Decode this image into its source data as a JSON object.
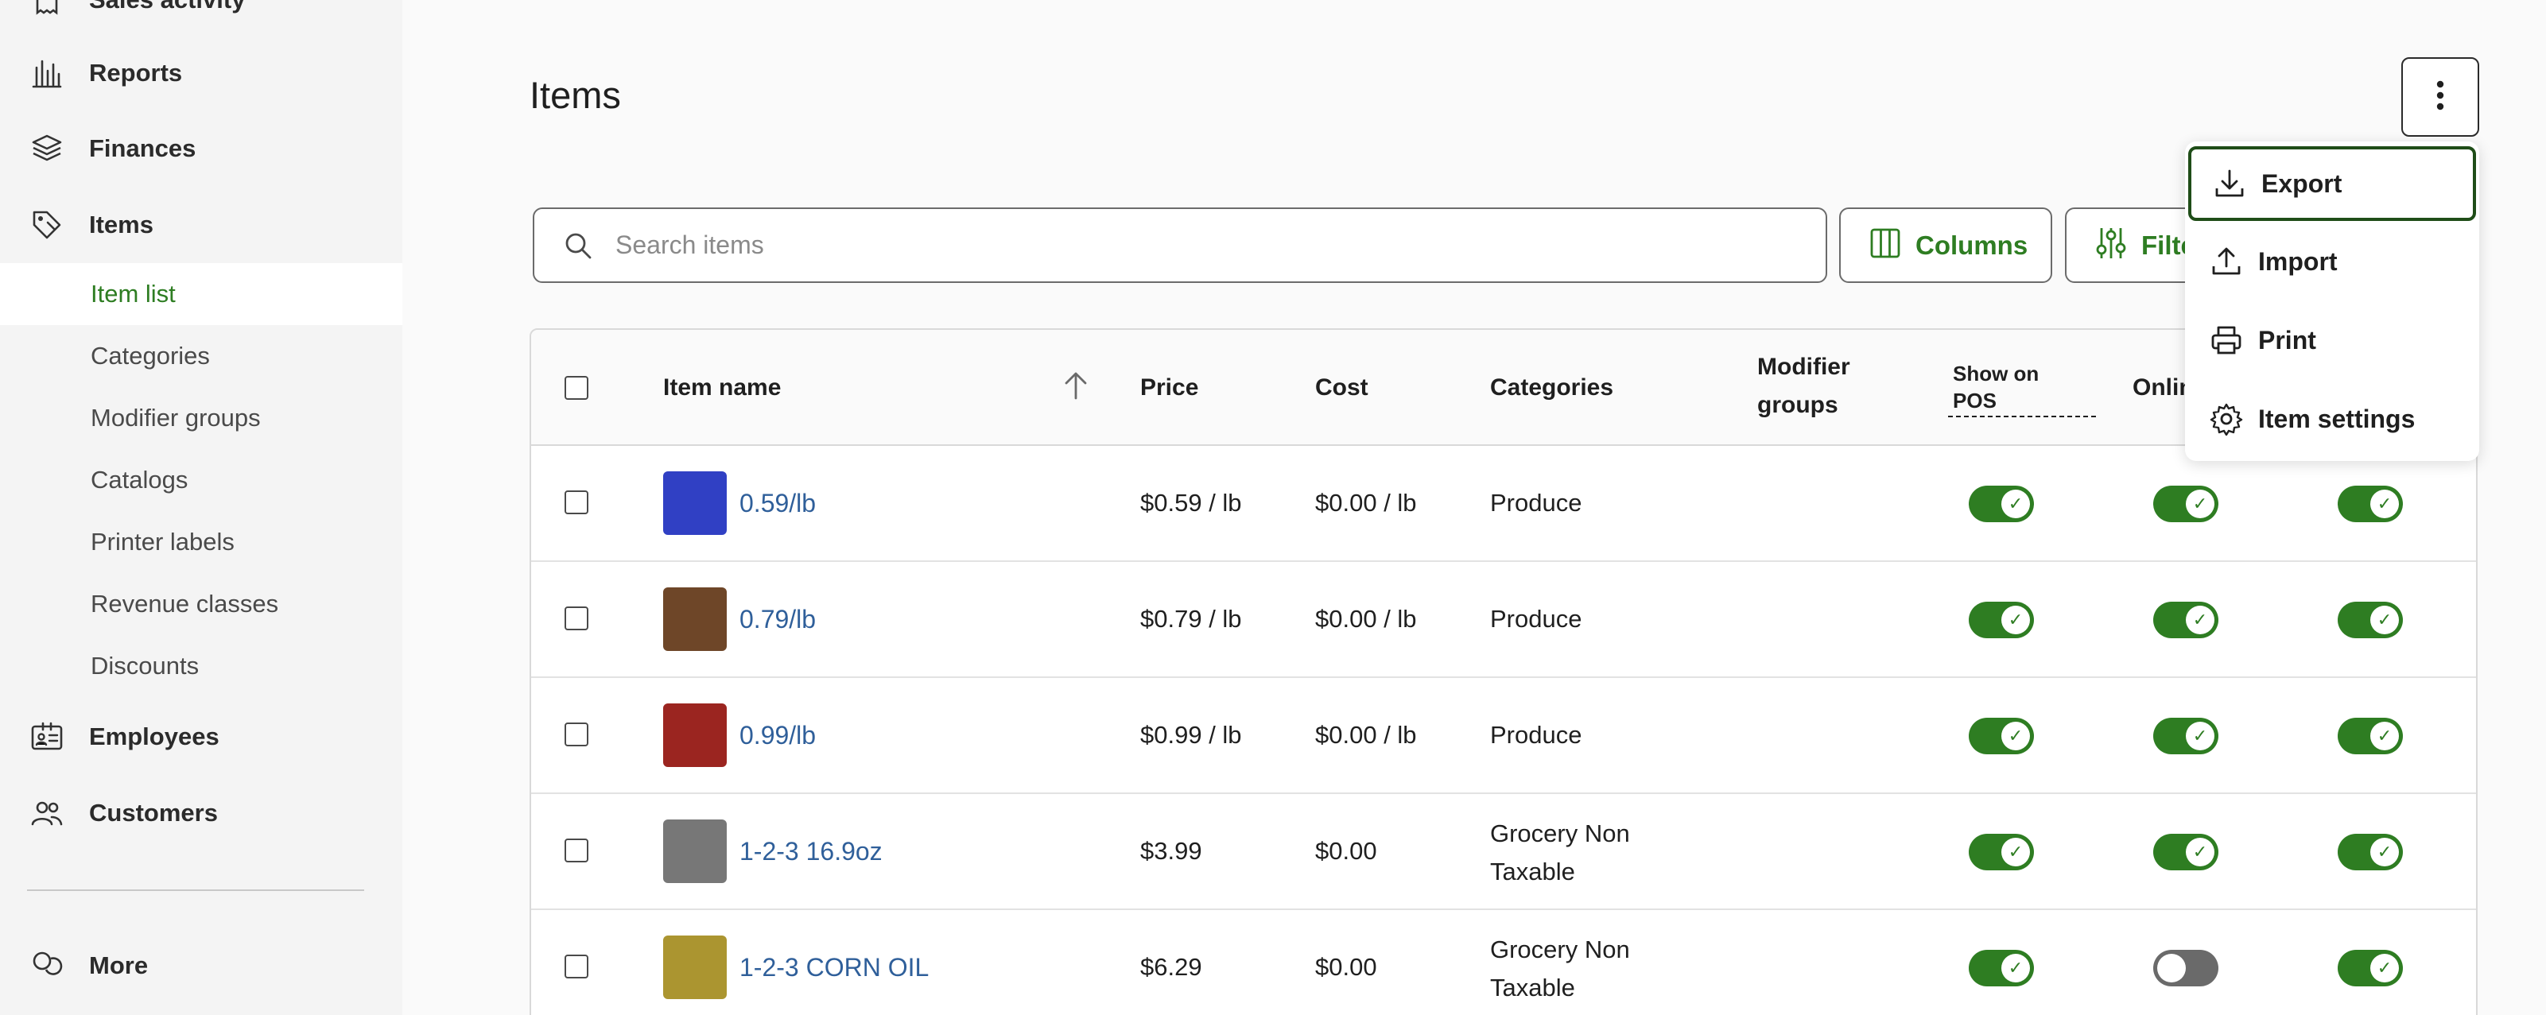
{
  "sidebar": {
    "partial_top_label": "Sales activity",
    "main_items": [
      {
        "label": "Reports",
        "icon": "bar-chart-icon"
      },
      {
        "label": "Finances",
        "icon": "layers-icon"
      },
      {
        "label": "Items",
        "icon": "tag-icon"
      }
    ],
    "sub_items": [
      {
        "label": "Item list",
        "active": true
      },
      {
        "label": "Categories"
      },
      {
        "label": "Modifier groups"
      },
      {
        "label": "Catalogs"
      },
      {
        "label": "Printer labels"
      },
      {
        "label": "Revenue classes"
      },
      {
        "label": "Discounts"
      }
    ],
    "bottom_items": [
      {
        "label": "Employees",
        "icon": "id-card-icon"
      },
      {
        "label": "Customers",
        "icon": "people-icon"
      }
    ],
    "more_label": "More"
  },
  "page": {
    "title": "Items"
  },
  "toolbar": {
    "search_placeholder": "Search items",
    "columns_label": "Columns",
    "filter_label": "Filters"
  },
  "table": {
    "headers": {
      "item_name": "Item name",
      "price": "Price",
      "cost": "Cost",
      "categories": "Categories",
      "modifier_groups_1": "Modifier",
      "modifier_groups_2": "groups",
      "show_on_pos_1": "Show on",
      "show_on_pos_2": "POS",
      "online": "Online"
    },
    "rows": [
      {
        "name": "0.59/lb",
        "color": "#3040c4",
        "price": "$0.59 / lb",
        "cost": "$0.00 / lb",
        "category": "Produce",
        "pos": true,
        "online": true,
        "third": true
      },
      {
        "name": "0.79/lb",
        "color": "#6e4628",
        "price": "$0.79 / lb",
        "cost": "$0.00 / lb",
        "category": "Produce",
        "pos": true,
        "online": true,
        "third": true
      },
      {
        "name": "0.99/lb",
        "color": "#9b2520",
        "price": "$0.99 / lb",
        "cost": "$0.00 / lb",
        "category": "Produce",
        "pos": true,
        "online": true,
        "third": true
      },
      {
        "name": "1-2-3 16.9oz",
        "color": "#777777",
        "price": "$3.99",
        "cost": "$0.00",
        "category_1": "Grocery Non",
        "category_2": "Taxable",
        "pos": true,
        "online": true,
        "third": true
      },
      {
        "name": "1-2-3 CORN OIL",
        "color": "#ab9530",
        "price": "$6.29",
        "cost": "$0.00",
        "category_1": "Grocery Non",
        "category_2": "Taxable",
        "pos": true,
        "online": false,
        "third": true
      }
    ]
  },
  "menu": {
    "items": [
      {
        "label": "Export",
        "icon": "download-icon"
      },
      {
        "label": "Import",
        "icon": "upload-icon"
      },
      {
        "label": "Print",
        "icon": "printer-icon"
      },
      {
        "label": "Item settings",
        "icon": "gear-icon"
      }
    ]
  },
  "colors": {
    "accent_green": "#2e7d22",
    "link_blue": "#2f5f9a",
    "toggle_off": "#6a6a6a"
  }
}
